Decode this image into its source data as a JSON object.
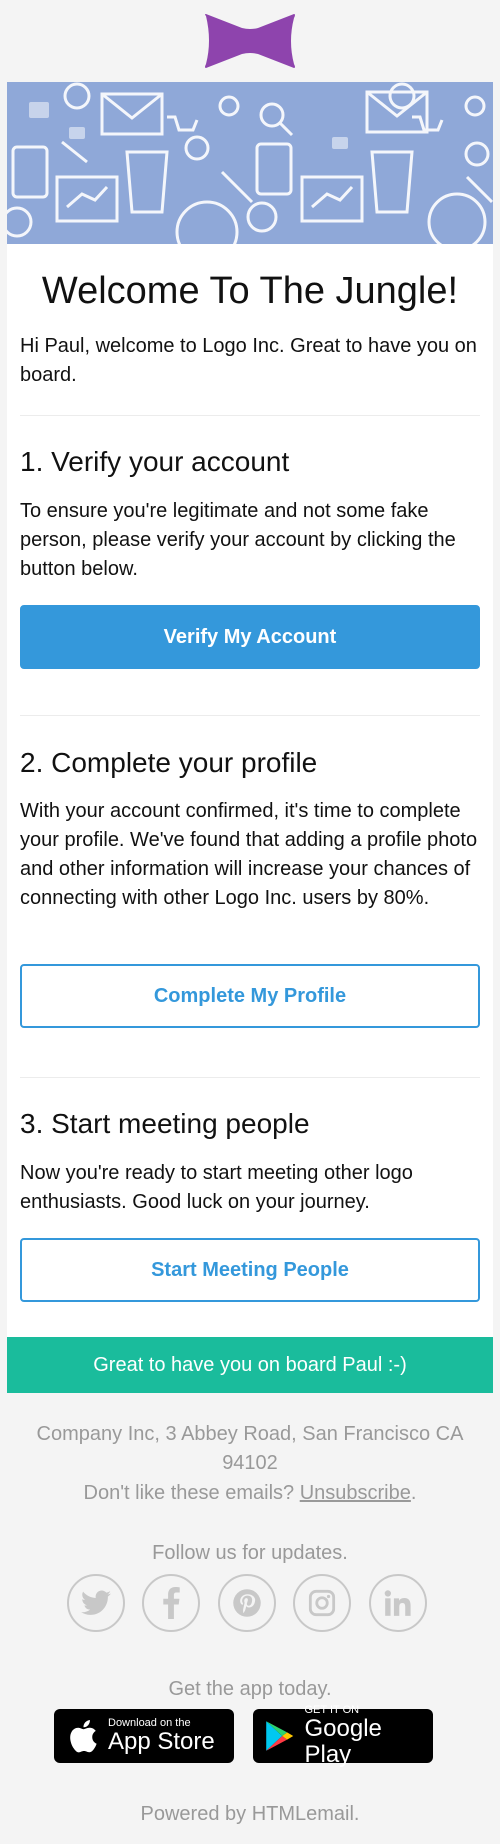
{
  "header": {
    "logo_icon": "bowtie-logo-icon",
    "logo_color": "#8e44ad"
  },
  "hero": {
    "image": "marketing-icons-pattern",
    "bg_color": "#8fa8d8"
  },
  "welcome": {
    "title": "Welcome To The Jungle!",
    "intro": "Hi Paul, welcome to Logo Inc. Great to have you on board."
  },
  "steps": [
    {
      "heading": "1. Verify your account",
      "text": "To ensure you're legitimate and not some fake person, please verify your account by clicking the button below.",
      "button": "Verify My Account"
    },
    {
      "heading": "2. Complete your profile",
      "text": "With your account confirmed, it's time to complete your profile. We've found that adding a profile photo and other information will increase your chances of connecting with other Logo Inc. users by 80%.",
      "button": "Complete My Profile"
    },
    {
      "heading": "3. Start meeting people",
      "text": "Now you're ready to start meeting other logo enthusiasts. Good luck on your journey.",
      "button": "Start Meeting People"
    }
  ],
  "banner": {
    "text": "Great to have you on board Paul :-)",
    "color": "#1abc9c"
  },
  "footer": {
    "address": "Company Inc, 3 Abbey Road, San Francisco CA 94102",
    "unsubscribe_prefix": "Don't like these emails?",
    "unsubscribe_link": "Unsubscribe",
    "unsubscribe_suffix": ".",
    "follow": "Follow us for updates.",
    "social_icons": [
      "twitter-icon",
      "facebook-icon",
      "pinterest-icon",
      "instagram-icon",
      "linkedin-icon"
    ],
    "get_app": "Get the app today.",
    "app_store_small": "Download on the",
    "app_store_big": "App Store",
    "google_play_small": "GET IT ON",
    "google_play_big": "Google Play",
    "powered": "Powered by HTMLemail."
  },
  "colors": {
    "accent": "#3498db",
    "muted": "#999999",
    "page_bg": "#f4f4f4"
  }
}
